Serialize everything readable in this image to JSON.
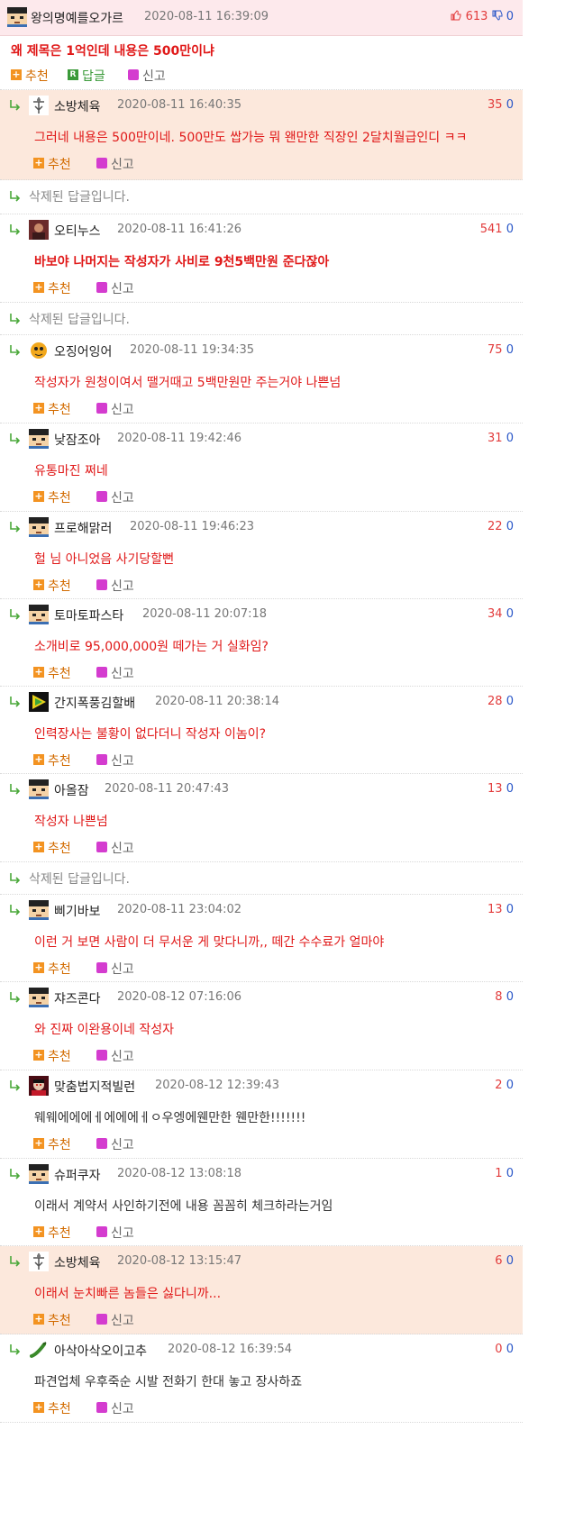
{
  "post": {
    "author": "왕의명예를오가르",
    "date": "2020-08-11 16:39:09",
    "up": "613",
    "down": "0",
    "title": "왜 제목은 1억인데 내용은 500만이냐",
    "recommend": "추천",
    "reply": "답글",
    "report": "신고"
  },
  "labels": {
    "recommend": "추천",
    "report": "신고",
    "deleted": "삭제된 답글입니다."
  },
  "comments": [
    {
      "type": "comment",
      "highlight": true,
      "nick": "소방체육",
      "date": "2020-08-11 16:40:35",
      "up": "35",
      "down": "0",
      "text": "그러네 내용은 500만이네. 500만도 쌉가능 뭐 왠만한 직장인 2달치월급인디 ㅋㅋ",
      "style": "red",
      "avatar": "cross"
    },
    {
      "type": "deleted",
      "text": "삭제된 답글입니다."
    },
    {
      "type": "comment",
      "highlight": false,
      "nick": "오티누스",
      "date": "2020-08-11 16:41:26",
      "up": "541",
      "down": "0",
      "text": "바보야 나머지는 작성자가 사비로 9천5백만원 준다잖아",
      "style": "red-bold",
      "avatar": "dark"
    },
    {
      "type": "deleted",
      "text": "삭제된 답글입니다."
    },
    {
      "type": "comment",
      "highlight": false,
      "nick": "오징어잉어",
      "date": "2020-08-11 19:34:35",
      "up": "75",
      "down": "0",
      "text": "작성자가 원청이여서 땔거때고 5백만원만 주는거야 나쁜넘",
      "style": "red",
      "avatar": "squid"
    },
    {
      "type": "comment",
      "highlight": false,
      "nick": "낮잠조아",
      "date": "2020-08-11 19:42:46",
      "up": "31",
      "down": "0",
      "text": "유통마진 쩌네",
      "style": "red",
      "avatar": "face"
    },
    {
      "type": "comment",
      "highlight": false,
      "nick": "프로해맑러",
      "date": "2020-08-11 19:46:23",
      "up": "22",
      "down": "0",
      "text": "헐 님 아니었음 사기당할뻔",
      "style": "red",
      "avatar": "face"
    },
    {
      "type": "comment",
      "highlight": false,
      "nick": "토마토파스타",
      "date": "2020-08-11 20:07:18",
      "up": "34",
      "down": "0",
      "text": "소개비로 95,000,000원 떼가는 거 실화임?",
      "style": "red",
      "avatar": "face"
    },
    {
      "type": "comment",
      "highlight": false,
      "nick": "간지폭풍김할배",
      "date": "2020-08-11 20:38:14",
      "up": "28",
      "down": "0",
      "text": "인력장사는 불황이 없다더니 작성자 이놈이?",
      "style": "red",
      "avatar": "play"
    },
    {
      "type": "comment",
      "highlight": false,
      "nick": "아올잠",
      "date": "2020-08-11 20:47:43",
      "up": "13",
      "down": "0",
      "text": "작성자 나쁜넘",
      "style": "red",
      "avatar": "face"
    },
    {
      "type": "deleted",
      "text": "삭제된 답글입니다."
    },
    {
      "type": "comment",
      "highlight": false,
      "nick": "삐기바보",
      "date": "2020-08-11 23:04:02",
      "up": "13",
      "down": "0",
      "text": "이런 거 보면 사람이 더 무서운 게 맞다니까,, 떼간 수수료가 얼마야",
      "style": "red",
      "avatar": "face"
    },
    {
      "type": "comment",
      "highlight": false,
      "nick": "쟈즈콘다",
      "date": "2020-08-12 07:16:06",
      "up": "8",
      "down": "0",
      "text": "와 진짜 이완용이네 작성자",
      "style": "red",
      "avatar": "face"
    },
    {
      "type": "comment",
      "highlight": false,
      "nick": "맞춤법지적빌런",
      "date": "2020-08-12 12:39:43",
      "up": "2",
      "down": "0",
      "text": "웨웨에에에ㅔ에에에ㅔㅇ우엥에웬만한 웬만한!!!!!!!",
      "style": "dark",
      "avatar": "villain"
    },
    {
      "type": "comment",
      "highlight": false,
      "nick": "슈퍼쿠자",
      "date": "2020-08-12 13:08:18",
      "up": "1",
      "down": "0",
      "text": "이래서 계약서 사인하기전에 내용 꼼꼼히 체크하라는거임",
      "style": "dark",
      "avatar": "face"
    },
    {
      "type": "comment",
      "highlight": true,
      "nick": "소방체육",
      "date": "2020-08-12 13:15:47",
      "up": "6",
      "down": "0",
      "text": "이래서 눈치빠른 놈들은 싫다니까...",
      "style": "red",
      "avatar": "cross"
    },
    {
      "type": "comment",
      "highlight": false,
      "nick": "아삭아삭오이고추",
      "date": "2020-08-12 16:39:54",
      "up": "0",
      "down": "0",
      "text": "파견업체 우후죽순 시발 전화기 한대 놓고 장사하죠",
      "style": "dark",
      "avatar": "pepper"
    }
  ],
  "colors": {
    "op_bg": "#fde9ec",
    "highlight_bg": "#fce8dc",
    "comment_red": "#e01818",
    "up": "#e23b3b",
    "down": "#2a57c8"
  }
}
